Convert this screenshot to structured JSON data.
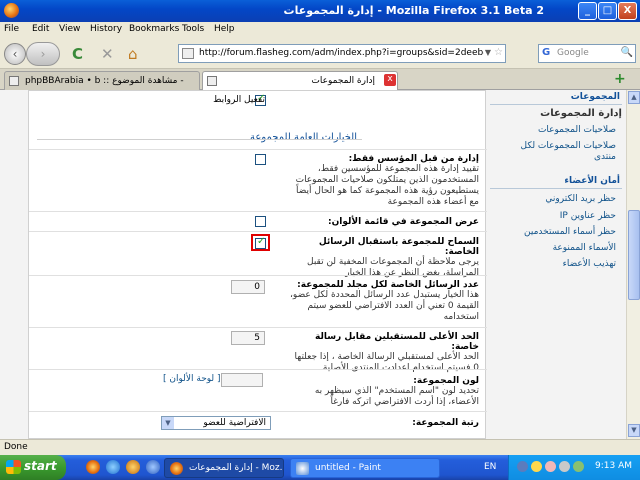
{
  "window": {
    "title": "إدارة المجموعات - Mozilla Firefox 3.1 Beta 2",
    "minimize": "_",
    "maximize": "□",
    "close": "X"
  },
  "menu": [
    "File",
    "Edit",
    "View",
    "History",
    "Bookmarks",
    "Tools",
    "Help"
  ],
  "nav": {
    "back": "‹",
    "forward": "›",
    "reload": "C",
    "stop": "✕",
    "home": "⌂",
    "url": "http://forum.flasheg.com/adm/index.php?i=groups&sid=2deeb87f961e",
    "url_drop": "▼",
    "star": "☆",
    "search_logo": "G",
    "search_placeholder": "Google",
    "search_icon": "🔍"
  },
  "tabs": [
    {
      "title": "phpBBArabia • b :: مشاهدة الموضوع -"
    },
    {
      "title": "إدارة المجموعات"
    }
  ],
  "tab_close": "x",
  "newtab": "+",
  "legend": "الخيارات العامة للمجموعة",
  "top_partial": "تفعيل الروابط",
  "options": [
    {
      "title": "إدارة من قبل المؤسس فقط:",
      "desc": "تقييد إدارة هذه المجموعة للمؤسسين فقط، المستخدمون الذين يمتلكون صلاحيات المجموعات يستطيعون رؤية هذه المجموعة كما هو الحال أيضاً مع أعضاء هذه المجموعة",
      "checked": false
    },
    {
      "title": "عرض المجموعة في قائمة الألوان:",
      "desc": "",
      "checked": false
    },
    {
      "title": "السماح للمجموعة باستقبال الرسائل الخاصة:",
      "desc": "يرجى ملاحظة أن المجموعات المخفية لن تقبل المراسلة، بغض النظر عن هذا الخيار",
      "checked": true
    }
  ],
  "numbers": [
    {
      "title": "عدد الرسائل الخاصة لكل مجلد للمجموعة:",
      "desc": "هذا الخيار يستبدل عدد الرسائل المحددة لكل عضو، القيمة 0 تعني أن العدد الافتراضي للعضو سيتم استخدامه",
      "value": "0"
    },
    {
      "title": "الحد الأعلى للمستقبلين مقابل رسالة خاصة:",
      "desc": "الحد الأعلى لمستقبلي الرسالة الخاصة ، إذا جعلتها 0 فسيتم استخدام اعدادت المنتدى الأصلية",
      "value": "5"
    }
  ],
  "color": {
    "title": "لون المجموعة:",
    "desc": "تحديد لون \"اسم المستخدم\" الذي سيظهر به الأعضاء، إذا أردت الافتراضي اتركه فارغاً",
    "palette_link": "[ لوحة الألوان ]"
  },
  "rank": {
    "title": "رتبة المجموعة:",
    "selected": "الافتراضية للعضو"
  },
  "sidebar": {
    "sections": [
      {
        "head": "المجموعات",
        "items": [
          "إدارة المجموعات",
          "صلاحيات المجموعات",
          "صلاحيات المجموعات لكل منتدى"
        ]
      },
      {
        "head": "أمان الأعضاء",
        "items": [
          "حظر بريد الكتروني",
          "حظر عناوين IP",
          "حظر أسماء المستخدمين",
          "الأسماء الممنوعة",
          "تهذيب الأعضاء"
        ]
      }
    ]
  },
  "status": "Done",
  "taskbar": {
    "start": "start",
    "items": [
      {
        "label": "إدارة المجموعات - Moz..."
      },
      {
        "label": "untitled - Paint"
      }
    ],
    "lang": "EN",
    "clock": "9:13 AM"
  },
  "colors": {
    "accent": "#115098",
    "link": "#105289",
    "highlight": "#e00000"
  }
}
